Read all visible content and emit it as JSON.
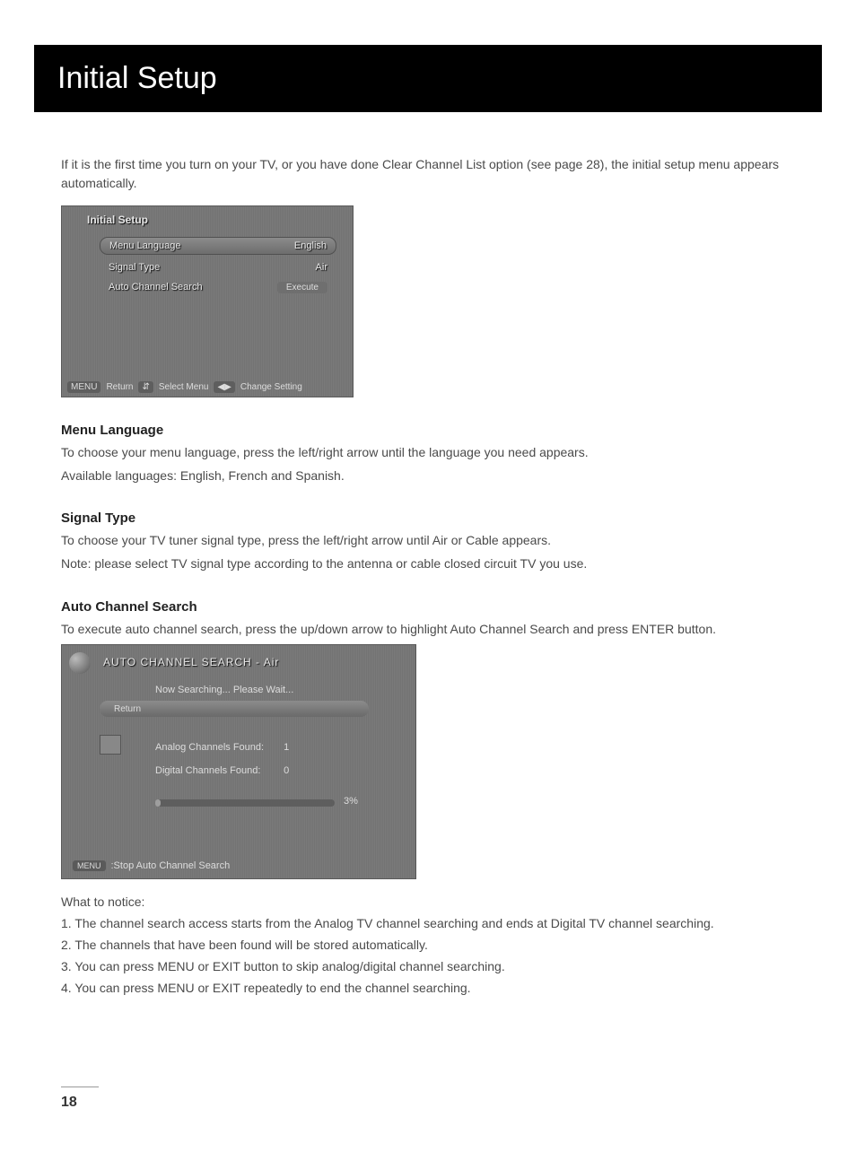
{
  "page": {
    "title": "Initial Setup",
    "intro": "If it is the first time you turn on your TV, or you have done Clear Channel List option (see page 28), the initial setup menu appears automatically.",
    "page_number": "18"
  },
  "tv_setup": {
    "title": "Initial Setup",
    "rows": {
      "menu_language": {
        "label": "Menu Language",
        "value": "English"
      },
      "signal_type": {
        "label": "Signal Type",
        "value": "Air"
      },
      "auto_search": {
        "label": "Auto Channel Search",
        "button": "Execute"
      }
    },
    "footer": {
      "return": "Return",
      "select": "Select Menu",
      "change": "Change Setting"
    }
  },
  "sections": {
    "menu_language": {
      "heading": "Menu Language",
      "p1": "To choose your menu language, press the left/right arrow until the language you need appears.",
      "p2": "Available languages: English, French and Spanish."
    },
    "signal_type": {
      "heading": "Signal Type",
      "p1": "To choose your TV tuner signal type, press the left/right arrow until Air or Cable appears.",
      "p2": "Note: please select TV signal type according to the antenna or cable closed circuit TV you use."
    },
    "auto_search": {
      "heading": "Auto Channel Search",
      "p1": "To execute auto channel search, press the up/down arrow to highlight Auto Channel Search and press ENTER button."
    }
  },
  "tv_search": {
    "title": "AUTO CHANNEL SEARCH - Air",
    "message": "Now Searching...  Please Wait...",
    "return_label": "Return",
    "analog": {
      "label": "Analog Channels Found:",
      "value": "1"
    },
    "digital": {
      "label": "Digital Channels Found:",
      "value": "0"
    },
    "progress_text": "3%",
    "stop_label": ":Stop Auto Channel Search",
    "stop_key": "MENU"
  },
  "notice": {
    "heading": "What to notice:",
    "items": [
      "1. The channel search access starts from the Analog TV channel searching and ends at Digital TV channel searching.",
      "2. The channels that have been found will be stored automatically.",
      "3. You can press MENU or EXIT button to skip analog/digital channel searching.",
      "4. You can press MENU or EXIT repeatedly to end the channel searching."
    ]
  }
}
